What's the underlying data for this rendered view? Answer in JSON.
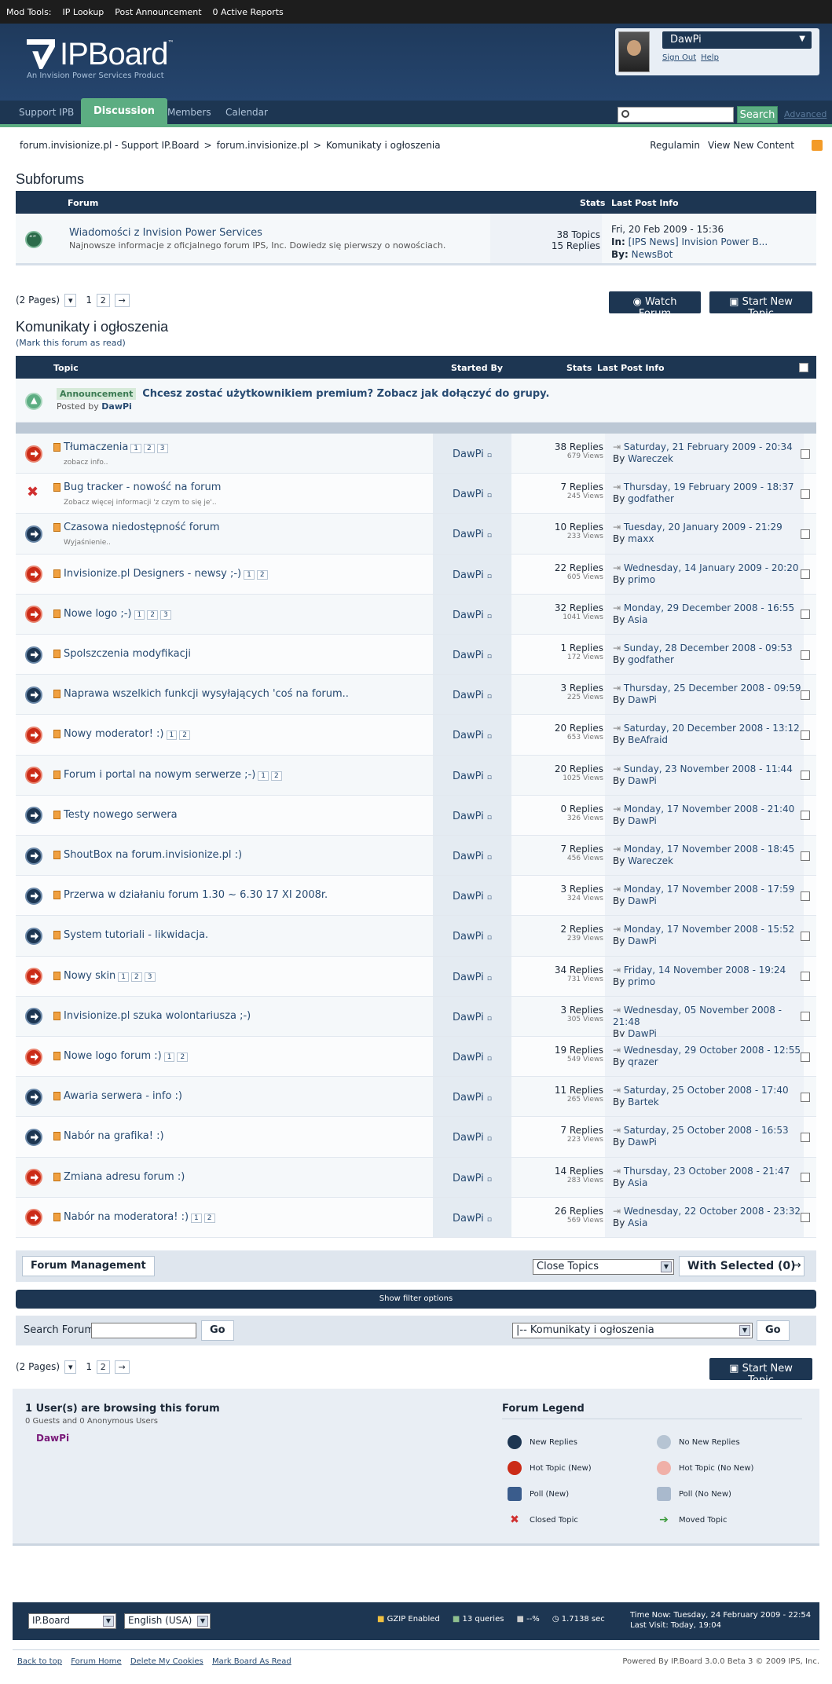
{
  "modbar": {
    "label": "Mod Tools:",
    "links": [
      "IP Lookup",
      "Post Announcement",
      "0 Active Reports"
    ]
  },
  "header": {
    "brand": "IPBoard",
    "tm": "™",
    "sub": "An Invision Power Services Product"
  },
  "user": {
    "name": "DawPi",
    "sign_out": "Sign Out",
    "help": "Help"
  },
  "nav": {
    "tabs": [
      "Support IPB",
      "Discussion",
      "Members",
      "Calendar"
    ],
    "search_btn": "Search",
    "advanced": "Advanced"
  },
  "breadcrumb": [
    "forum.invisionize.pl - Support IP.Board",
    ">",
    "forum.invisionize.pl",
    ">",
    "Komunikaty i ogłoszenia"
  ],
  "toplinks": [
    "Regulamin",
    "View New Content"
  ],
  "subforums": {
    "title": "Subforums",
    "headers": {
      "forum": "Forum",
      "stats": "Stats",
      "last": "Last Post Info"
    },
    "item": {
      "name": "Wiadomości z Invision Power Services",
      "desc": "Najnowsze informacje z oficjalnego forum IPS, Inc. Dowiedz się pierwszy o nowościach.",
      "topics": "38 Topics",
      "replies": "15 Replies",
      "date": "Fri, 20 Feb 2009 - 15:36",
      "in_label": "In:",
      "in_link": "[IPS News] Invision Power B...",
      "by_label": "By:",
      "by_link": "NewsBot"
    }
  },
  "pager": {
    "label": "(2 Pages)",
    "p1": "1",
    "p2": "2",
    "next": "→"
  },
  "buttons": {
    "watch": "Watch Forum",
    "new_topic": "Start New Topic"
  },
  "forum": {
    "title": "Komunikaty i ogłoszenia",
    "mark_read": "(Mark this forum as read)"
  },
  "table_headers": {
    "topic": "Topic",
    "started": "Started By",
    "stats": "Stats",
    "last": "Last Post Info"
  },
  "announcement": {
    "badge": "Announcement",
    "title": "Chcesz zostać użytkownikiem premium? Zobacz jak dołączyć do grupy.",
    "posted_by": "Posted by",
    "author": "DawPi"
  },
  "topics": [
    {
      "title": "Tłumaczenia",
      "desc": "zobacz info..",
      "pages": [
        "1",
        "2",
        "3"
      ],
      "starter": "DawPi",
      "replies": "38 Replies",
      "views": "679 Views",
      "date": "Saturday, 21 February 2009 - 20:34",
      "by": "Wareczek",
      "status": "hot"
    },
    {
      "title": "Bug tracker - nowość na forum",
      "desc": "Zobacz więcej informacji 'z czym to się je'..",
      "pages": [],
      "starter": "DawPi",
      "replies": "7 Replies",
      "views": "245 Views",
      "date": "Thursday, 19 February 2009 - 18:37",
      "by": "godfather",
      "status": "closed"
    },
    {
      "title": "Czasowa niedostępność forum",
      "desc": "Wyjaśnienie..",
      "pages": [],
      "starter": "DawPi",
      "replies": "10 Replies",
      "views": "233 Views",
      "date": "Tuesday, 20 January 2009 - 21:29",
      "by": "maxx",
      "status": "new"
    },
    {
      "title": "Invisionize.pl Designers - newsy ;-)",
      "desc": "",
      "pages": [
        "1",
        "2"
      ],
      "starter": "DawPi",
      "replies": "22 Replies",
      "views": "605 Views",
      "date": "Wednesday, 14 January 2009 - 20:20",
      "by": "primo",
      "status": "hot"
    },
    {
      "title": "Nowe logo ;-)",
      "desc": "",
      "pages": [
        "1",
        "2",
        "3"
      ],
      "starter": "DawPi",
      "replies": "32 Replies",
      "views": "1041 Views",
      "date": "Monday, 29 December 2008 - 16:55",
      "by": "Asia",
      "status": "hot"
    },
    {
      "title": "Spolszczenia modyfikacji",
      "desc": "",
      "pages": [],
      "starter": "DawPi",
      "replies": "1 Replies",
      "views": "172 Views",
      "date": "Sunday, 28 December 2008 - 09:53",
      "by": "godfather",
      "status": "new"
    },
    {
      "title": "Naprawa wszelkich funkcji wysyłających 'coś na forum..",
      "desc": "",
      "pages": [],
      "starter": "DawPi",
      "replies": "3 Replies",
      "views": "225 Views",
      "date": "Thursday, 25 December 2008 - 09:59",
      "by": "DawPi",
      "status": "new"
    },
    {
      "title": "Nowy moderator! :)",
      "desc": "",
      "pages": [
        "1",
        "2"
      ],
      "starter": "DawPi",
      "replies": "20 Replies",
      "views": "653 Views",
      "date": "Saturday, 20 December 2008 - 13:12",
      "by": "BeAfraid",
      "status": "hot"
    },
    {
      "title": "Forum i portal na nowym serwerze ;-)",
      "desc": "",
      "pages": [
        "1",
        "2"
      ],
      "starter": "DawPi",
      "replies": "20 Replies",
      "views": "1025 Views",
      "date": "Sunday, 23 November 2008 - 11:44",
      "by": "DawPi",
      "status": "hot"
    },
    {
      "title": "Testy nowego serwera",
      "desc": "",
      "pages": [],
      "starter": "DawPi",
      "replies": "0 Replies",
      "views": "326 Views",
      "date": "Monday, 17 November 2008 - 21:40",
      "by": "DawPi",
      "status": "new"
    },
    {
      "title": "ShoutBox na forum.invisionize.pl :)",
      "desc": "",
      "pages": [],
      "starter": "DawPi",
      "replies": "7 Replies",
      "views": "456 Views",
      "date": "Monday, 17 November 2008 - 18:45",
      "by": "Wareczek",
      "status": "new"
    },
    {
      "title": "Przerwa w działaniu forum 1.30 ~ 6.30 17 XI 2008r.",
      "desc": "",
      "pages": [],
      "starter": "DawPi",
      "replies": "3 Replies",
      "views": "324 Views",
      "date": "Monday, 17 November 2008 - 17:59",
      "by": "DawPi",
      "status": "new"
    },
    {
      "title": "System tutoriali - likwidacja.",
      "desc": "",
      "pages": [],
      "starter": "DawPi",
      "replies": "2 Replies",
      "views": "239 Views",
      "date": "Monday, 17 November 2008 - 15:52",
      "by": "DawPi",
      "status": "new"
    },
    {
      "title": "Nowy skin",
      "desc": "",
      "pages": [
        "1",
        "2",
        "3"
      ],
      "starter": "DawPi",
      "replies": "34 Replies",
      "views": "731 Views",
      "date": "Friday, 14 November 2008 - 19:24",
      "by": "primo",
      "status": "hot"
    },
    {
      "title": "Invisionize.pl szuka wolontariusza ;-)",
      "desc": "",
      "pages": [],
      "starter": "DawPi",
      "replies": "3 Replies",
      "views": "305 Views",
      "date": "Wednesday, 05 November 2008 - 21:48",
      "by": "DawPi",
      "status": "new"
    },
    {
      "title": "Nowe logo forum :)",
      "desc": "",
      "pages": [
        "1",
        "2"
      ],
      "starter": "DawPi",
      "replies": "19 Replies",
      "views": "549 Views",
      "date": "Wednesday, 29 October 2008 - 12:55",
      "by": "qrazer",
      "status": "hot"
    },
    {
      "title": "Awaria serwera - info :)",
      "desc": "",
      "pages": [],
      "starter": "DawPi",
      "replies": "11 Replies",
      "views": "265 Views",
      "date": "Saturday, 25 October 2008 - 17:40",
      "by": "Bartek",
      "status": "new"
    },
    {
      "title": "Nabór na grafika! :)",
      "desc": "",
      "pages": [],
      "starter": "DawPi",
      "replies": "7 Replies",
      "views": "223 Views",
      "date": "Saturday, 25 October 2008 - 16:53",
      "by": "DawPi",
      "status": "new"
    },
    {
      "title": "Zmiana adresu forum :)",
      "desc": "",
      "pages": [],
      "starter": "DawPi",
      "replies": "14 Replies",
      "views": "283 Views",
      "date": "Thursday, 23 October 2008 - 21:47",
      "by": "Asia",
      "status": "hot"
    },
    {
      "title": "Nabór na moderatora! :)",
      "desc": "",
      "pages": [
        "1",
        "2"
      ],
      "starter": "DawPi",
      "replies": "26 Replies",
      "views": "569 Views",
      "date": "Wednesday, 22 October 2008 - 23:32",
      "by": "Asia",
      "status": "hot"
    }
  ],
  "by_label": "By",
  "modbar_bottom": {
    "manage": "Forum Management",
    "close_topics": "Close Topics",
    "with_selected": "With Selected (0)"
  },
  "filter": "Show filter options",
  "searchforum": {
    "label": "Search Forum",
    "go": "Go",
    "jump": "|-- Komunikaty i ogłoszenia",
    "go2": "Go"
  },
  "browsing": {
    "title": "1 User(s) are browsing this forum",
    "sub": "0 Guests and 0 Anonymous Users",
    "user": "DawPi"
  },
  "legend": {
    "title": "Forum Legend",
    "items": [
      "New Replies",
      "No New Replies",
      "Hot Topic (New)",
      "Hot Topic (No New)",
      "Poll (New)",
      "Poll (No New)",
      "Closed Topic",
      "Moved Topic"
    ]
  },
  "footer": {
    "skin": "IP.Board",
    "lang": "English (USA)",
    "gzip": "GZIP Enabled",
    "queries": "13 queries",
    "mem": "--%",
    "time": "1.7138 sec",
    "now": "Time Now: Tuesday, 24 February 2009 - 22:54",
    "last": "Last Visit: Today, 19:04"
  },
  "footlinks": [
    "Back to top",
    "Forum Home",
    "Delete My Cookies",
    "Mark Board As Read"
  ],
  "copyright": "Powered By IP.Board 3.0.0 Beta 3 © 2009  IPS, Inc."
}
